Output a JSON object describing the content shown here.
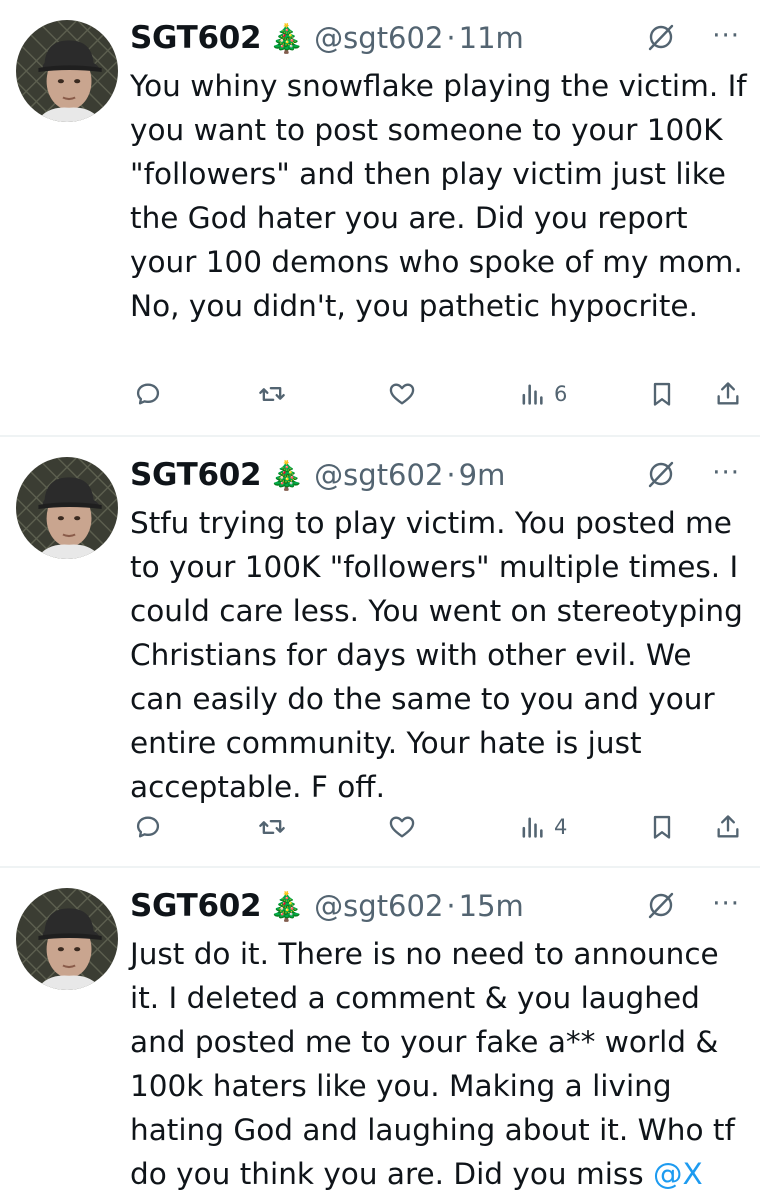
{
  "tweets": [
    {
      "name": "SGT602",
      "emoji": "🎄",
      "handle": "@sgt602",
      "dot": "·",
      "time": "11m",
      "text": "You whiny snowflake playing the victim. If you want to post someone to your 100K \"followers\" and then play victim just like the God hater you are. Did you report your 100 demons who spoke of my mom. No, you didn't, you pathetic hypocrite.",
      "mention": "",
      "views": "6",
      "more": "···"
    },
    {
      "name": "SGT602",
      "emoji": "🎄",
      "handle": "@sgt602",
      "dot": "·",
      "time": "9m",
      "text": "Stfu trying to play victim. You posted me to your 100K \"followers\" multiple times. I could care less. You went on stereotyping Christians for days with other evil. We can easily do the same to you and your entire community. Your hate is just acceptable. F off.",
      "mention": "",
      "views": "4",
      "more": "···"
    },
    {
      "name": "SGT602",
      "emoji": "🎄",
      "handle": "@sgt602",
      "dot": "·",
      "time": "15m",
      "text": "Just do it. There is no need to announce it. I deleted a comment & you laughed and posted me to your fake a** world & 100k haters like you. Making a living hating God and laughing about it. Who tf do you think you are. Did you miss ",
      "mention": "@X",
      "more": "···"
    }
  ],
  "colors": {
    "text": "#0f1419",
    "secondary": "#536471",
    "link": "#1d9bf0",
    "divider": "#eff3f4"
  },
  "icons": {
    "reply": "reply-icon",
    "retweet": "retweet-icon",
    "like": "like-icon",
    "views": "views-icon",
    "bookmark": "bookmark-icon",
    "share": "share-icon",
    "grok": "grok-icon",
    "more": "more-icon"
  }
}
